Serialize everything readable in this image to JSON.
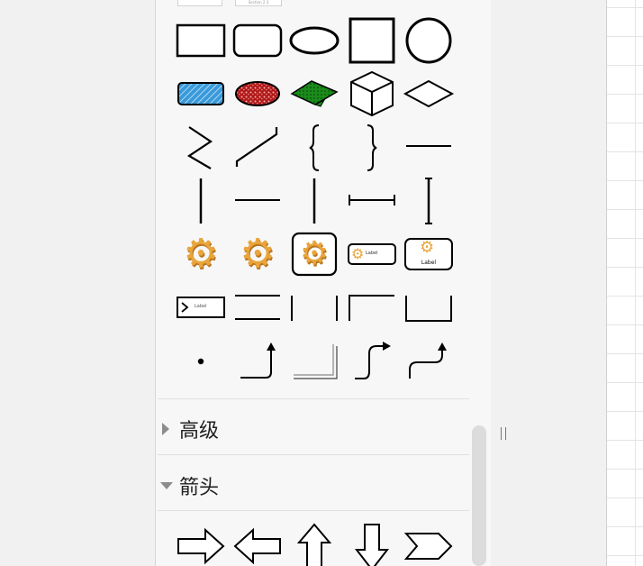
{
  "sections": {
    "advanced": {
      "title": "高级",
      "expanded": false
    },
    "arrows": {
      "title": "箭头",
      "expanded": true
    }
  },
  "tiny_tab_label": "Section 2.3",
  "shapes": {
    "labeled_box_text": "Label",
    "gear_label_text": "Label",
    "gear_card_label": "Label"
  },
  "colors": {
    "panel_bg": "#f7f7f7",
    "hatched_blue": "#3a9ad9",
    "cloud_red": "#b01818",
    "patch_green": "#1a8c1a",
    "gear": "#e9a53b"
  },
  "icons": [
    "rectangle-icon",
    "rounded-rectangle-icon",
    "ellipse-icon",
    "square-icon",
    "circle-icon",
    "hatched-rectangle-icon",
    "red-textured-ellipse-icon",
    "green-textured-rhombus-icon",
    "cube-icon",
    "rhombus-icon",
    "zigzag-line-icon",
    "slanted-connector-icon",
    "left-brace-icon",
    "right-brace-icon",
    "horizontal-line-icon",
    "vertical-line-icon",
    "horizontal-line-icon",
    "vertical-line-icon",
    "horizontal-dimension-icon",
    "vertical-dimension-icon",
    "gear-icon",
    "gear-icon",
    "gear-in-rounded-box-icon",
    "gear-labeled-box-icon",
    "gear-label-card-icon",
    "labeled-play-box-icon",
    "double-horizontal-line-icon",
    "vertical-pair-lines-icon",
    "corner-bracket-icon",
    "u-bracket-icon",
    "dot-icon",
    "elbow-arrow-up-icon",
    "shadow-corner-icon",
    "curved-arrow-right-icon",
    "curved-arrow-up-icon",
    "arrow-right-icon",
    "arrow-left-icon",
    "arrow-up-icon",
    "arrow-down-icon",
    "chevron-right-icon"
  ]
}
